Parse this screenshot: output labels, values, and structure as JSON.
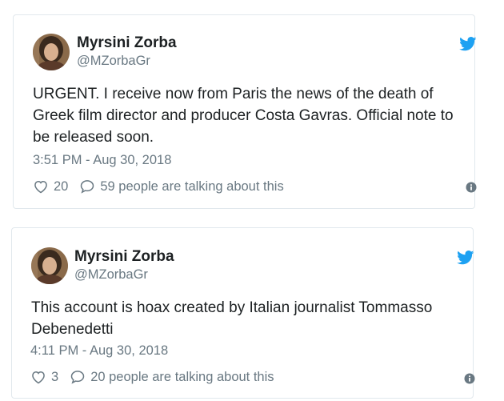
{
  "colors": {
    "twitter_blue": "#1da1f2",
    "text": "#1c2022",
    "secondary": "#697882",
    "border": "#e1e8ed"
  },
  "tweets": [
    {
      "name": "Myrsini Zorba",
      "handle": "@MZorbaGr",
      "text": "URGENT. I receive now from Paris the news of the death of Greek film director and producer Costa Gavras. Official note to be released soon.",
      "timestamp": "3:51 PM - Aug 30, 2018",
      "likes": "20",
      "replies": "59 people are talking about this",
      "icons": [
        "avatar",
        "twitter-bird-icon",
        "heart-icon",
        "comment-icon",
        "info-icon"
      ]
    },
    {
      "name": "Myrsini Zorba",
      "handle": "@MZorbaGr",
      "text": "This account is hoax created by Italian journalist   Tommasso Debenedetti",
      "timestamp": "4:11 PM - Aug 30, 2018",
      "likes": "3",
      "replies": "20 people are talking about this",
      "icons": [
        "avatar",
        "twitter-bird-icon",
        "heart-icon",
        "comment-icon",
        "info-icon"
      ]
    }
  ]
}
